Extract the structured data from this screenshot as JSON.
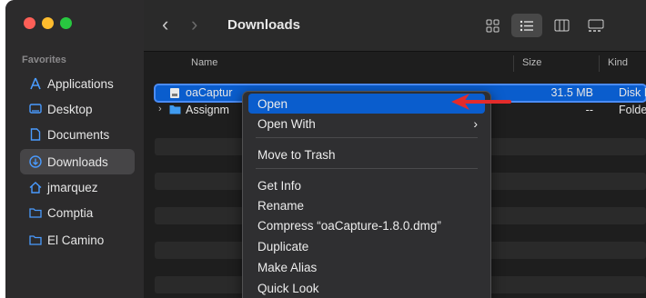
{
  "window": {
    "title": "Downloads",
    "nav": {
      "back": "‹",
      "forward": "›"
    }
  },
  "sidebar": {
    "section": "Favorites",
    "items": [
      {
        "label": "Applications",
        "icon": "applications-icon"
      },
      {
        "label": "Desktop",
        "icon": "desktop-icon"
      },
      {
        "label": "Documents",
        "icon": "documents-icon"
      },
      {
        "label": "Downloads",
        "icon": "downloads-icon",
        "active": true
      },
      {
        "label": "jmarquez",
        "icon": "home-icon"
      },
      {
        "label": "Comptia",
        "icon": "folder-icon"
      },
      {
        "label": "El Camino",
        "icon": "folder-icon"
      }
    ]
  },
  "columns": {
    "name": "Name",
    "size": "Size",
    "kind": "Kind"
  },
  "files": [
    {
      "name": "oaCaptur",
      "size": "31.5 MB",
      "kind": "Disk I",
      "selected": true
    },
    {
      "name": "Assignm",
      "size": "--",
      "kind": "Folde",
      "folder": true
    }
  ],
  "context_menu": {
    "items": [
      "Open",
      "Open With",
      "Move to Trash",
      "Get Info",
      "Rename",
      "Compress “oaCapture-1.8.0.dmg”",
      "Duplicate",
      "Make Alias",
      "Quick Look"
    ],
    "submenu_glyph": "›",
    "highlight_color": "#0a5dcd"
  },
  "annotation": {
    "arrow_color": "#e32b2b"
  }
}
